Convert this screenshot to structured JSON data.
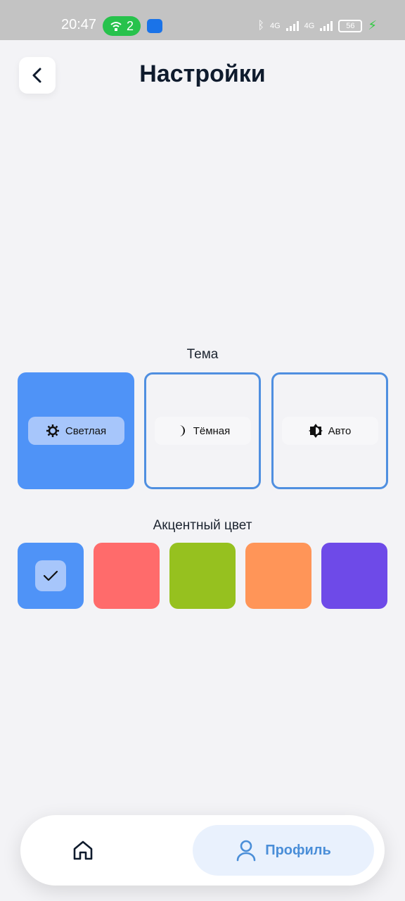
{
  "status_bar": {
    "time": "20:47",
    "hotspot_count": "2",
    "network_1": "4G",
    "network_2": "4G",
    "battery": "56",
    "icons": [
      "hotspot-icon",
      "android-app-icon",
      "bluetooth-icon",
      "signal-icon",
      "battery-icon",
      "charging-icon"
    ]
  },
  "header": {
    "title": "Настройки",
    "back_icon": "chevron-left-icon"
  },
  "theme": {
    "label": "Тема",
    "options": [
      {
        "label": "Светлая",
        "icon": "sun-icon",
        "selected": true
      },
      {
        "label": "Тёмная",
        "icon": "moon-icon",
        "selected": false
      },
      {
        "label": "Авто",
        "icon": "auto-brightness-icon",
        "selected": false
      }
    ]
  },
  "accent": {
    "label": "Акцентный цвет",
    "colors": [
      {
        "hex": "#4f93f7",
        "selected": true
      },
      {
        "hex": "#ff6b6b",
        "selected": false
      },
      {
        "hex": "#96c11f",
        "selected": false
      },
      {
        "hex": "#ff9558",
        "selected": false
      },
      {
        "hex": "#6e4ae8",
        "selected": false
      }
    ]
  },
  "bottom_nav": {
    "home_icon": "home-icon",
    "profile_label": "Профиль",
    "profile_icon": "user-icon",
    "active": "profile"
  }
}
